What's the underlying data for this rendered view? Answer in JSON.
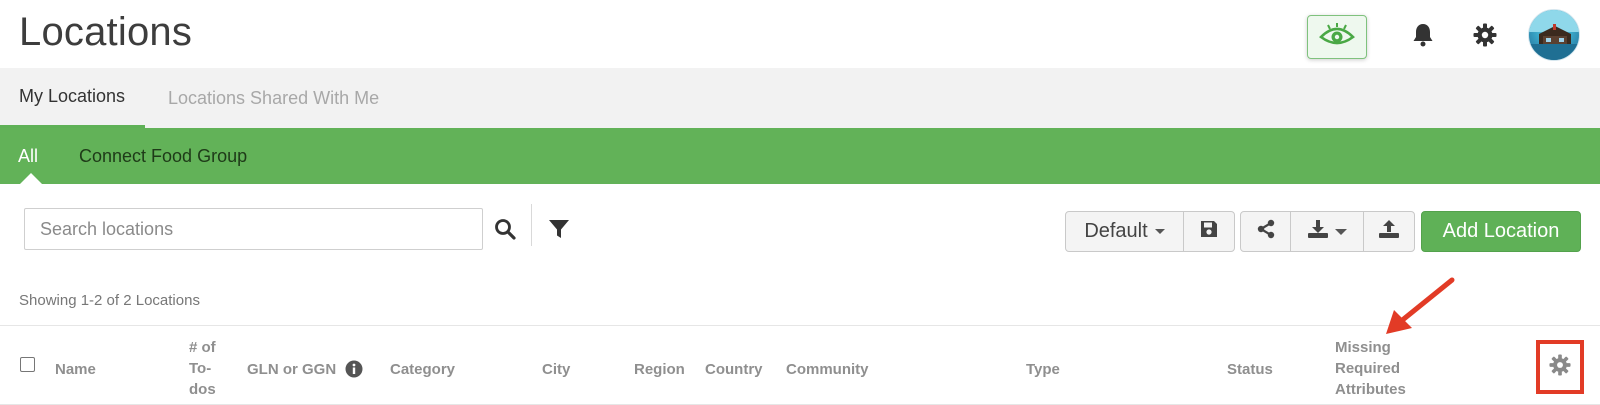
{
  "header": {
    "title": "Locations",
    "icons": {
      "eye": "eye-icon",
      "bell": "bell-icon",
      "settings": "gear-icon",
      "avatar": "avatar"
    }
  },
  "tabs": [
    {
      "label": "My Locations",
      "active": true
    },
    {
      "label": "Locations Shared With Me",
      "active": false
    }
  ],
  "subnav": [
    {
      "label": "All",
      "active": true
    },
    {
      "label": "Connect Food Group",
      "active": false
    }
  ],
  "toolbar": {
    "search_placeholder": "Search locations",
    "view_label": "Default",
    "add_label": "Add Location",
    "icons": [
      "search-icon",
      "filter-icon",
      "save-icon",
      "share-icon",
      "download-icon",
      "upload-icon"
    ]
  },
  "showing": "Showing 1-2 of 2 Locations",
  "table": {
    "columns": [
      {
        "label": "Name"
      },
      {
        "label": "# of To-dos",
        "lines": [
          "# of",
          "To-",
          "dos"
        ]
      },
      {
        "label": "GLN or GGN"
      },
      {
        "label": "Category"
      },
      {
        "label": "City"
      },
      {
        "label": "Region"
      },
      {
        "label": "Country"
      },
      {
        "label": "Community"
      },
      {
        "label": "Type"
      },
      {
        "label": "Status"
      },
      {
        "label": "Missing Required Attributes",
        "lines": [
          "Missing",
          "Required",
          "Attributes"
        ]
      }
    ]
  },
  "colors": {
    "brand_green": "#62b258",
    "annotation_red": "#e23b26",
    "header_gray": "#8f8f8f"
  }
}
